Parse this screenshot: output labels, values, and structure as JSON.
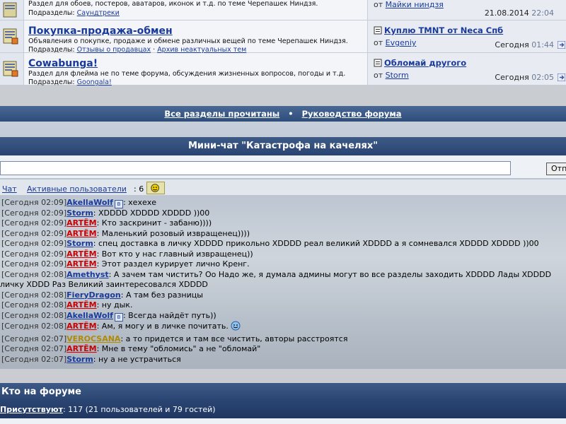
{
  "forums": [
    {
      "desc": "Раздел для обоев, постеров, аватаров, иконок и т.д. по теме Черепашек Ниндзя.",
      "subs_label": "Подразделы:",
      "subs": [
        "Саундтреки"
      ],
      "last_by_label": "от",
      "last_author": "Майки ниндзя",
      "last_date": "21.08.2014",
      "last_time": "22:04"
    },
    {
      "title": "Покупка-продажа-обмен",
      "desc": "Объявления о покупке, продаже и обмене различных вещей по теме Черепашек Ниндзя.",
      "subs_label": "Подразделы:",
      "subs": [
        "Отзывы о продавцах",
        "Архив неактуальных тем"
      ],
      "last_topic": "Куплю TMNT от Neca Спб",
      "last_by_label": "от",
      "last_author": "Evgeniy",
      "last_date": "Сегодня",
      "last_time": "01:44"
    },
    {
      "title": "Cowabunga!",
      "desc": "Раздел для флейма не по теме форума, обсуждения жизненных вопросов, погоды и т.д.",
      "subs_label": "Подразделы:",
      "subs": [
        "Goongala!"
      ],
      "last_topic": "Обломай другого",
      "last_by_label": "от",
      "last_author": "Storm",
      "last_date": "Сегодня",
      "last_time": "02:05"
    }
  ],
  "forum_bar": {
    "mark_read": "Все разделы прочитаны",
    "separator": "•",
    "guide": "Руководство форума"
  },
  "chat": {
    "title": "Мини-чат \"Катастрофа на качелях\"",
    "input_value": "",
    "send_label": "Отп",
    "tab_chat": "Чат",
    "tab_active": "Активные пользователи",
    "active_count_text": ": 6",
    "messages": [
      {
        "time": "[Сегодня 02:09]",
        "user": "AkellaWolf",
        "color": "blue",
        "badge": true,
        "text": ": хехехе"
      },
      {
        "time": "[Сегодня 02:09]",
        "user": "Storm",
        "color": "blue",
        "text": ": XDDDD XDDDD XDDDD ))00"
      },
      {
        "time": "[Сегодня 02:09]",
        "user": "ARTЁМ",
        "color": "red",
        "text": ": Кто заскринит - забаню))))"
      },
      {
        "time": "[Сегодня 02:09]",
        "user": "ARTЁМ",
        "color": "red",
        "text": ": Маленький розовый извращенец))))"
      },
      {
        "time": "[Сегодня 02:09]",
        "user": "Storm",
        "color": "blue",
        "text": ": спец доставка в личку XDDDD прикольно XDDDD реал великий XDDDD а я сомневался XDDDD XDDDD ))00"
      },
      {
        "time": "[Сегодня 02:09]",
        "user": "ARTЁМ",
        "color": "red",
        "text": ": Вот кто у нас главный извращенец))"
      },
      {
        "time": "[Сегодня 02:09]",
        "user": "ARTЁМ",
        "color": "red",
        "text": ": Этот раздел курирует лично Кренг."
      },
      {
        "time": "[Сегодня 02:08]",
        "user": "Amethyst",
        "color": "blue",
        "text": ": А зачем там чистить? Оо Надо же, я думала админы могут во все разделы заходить XDDDD Лады XDDDD",
        "cont": "личку XDDD Раз Великий заинтересовался XDDDD"
      },
      {
        "time": "[Сегодня 02:08]",
        "user": "FieryDragon",
        "color": "blue",
        "text": ": А там без разницы"
      },
      {
        "time": "[Сегодня 02:08]",
        "user": "ARTЁМ",
        "color": "red",
        "text": ": ну дык."
      },
      {
        "time": "[Сегодня 02:08]",
        "user": "AkellaWolf",
        "color": "blue",
        "badge": true,
        "text": ": Всегда найдёт путь))"
      },
      {
        "time": "[Сегодня 02:08]",
        "user": "ARTЁМ",
        "color": "red",
        "text": ": Ам, я могу и в личке почитать.",
        "emoji": true
      },
      {
        "time": "[Сегодня 02:07]",
        "user": "VEROCSANA",
        "color": "gold",
        "text": ": а то придется и там все чистить, авторы расстроятся"
      },
      {
        "time": "[Сегодня 02:07]",
        "user": "ARTЁМ",
        "color": "red",
        "text": ": Мне в тему \"обломись\" а не \"обломай\""
      },
      {
        "time": "[Сегодня 02:07]",
        "user": "Storm",
        "color": "blue",
        "text": ": ну а не устрачиться"
      }
    ]
  },
  "who": {
    "title": "Кто на форуме",
    "present_label": "Присутствуют",
    "present_text": ": 117 (21 пользователей и 79 гостей)"
  },
  "colors": {
    "bar": "#2f4d7b",
    "link": "#1a3a9a",
    "admin": "#cc0000",
    "moder": "#b08a00"
  }
}
